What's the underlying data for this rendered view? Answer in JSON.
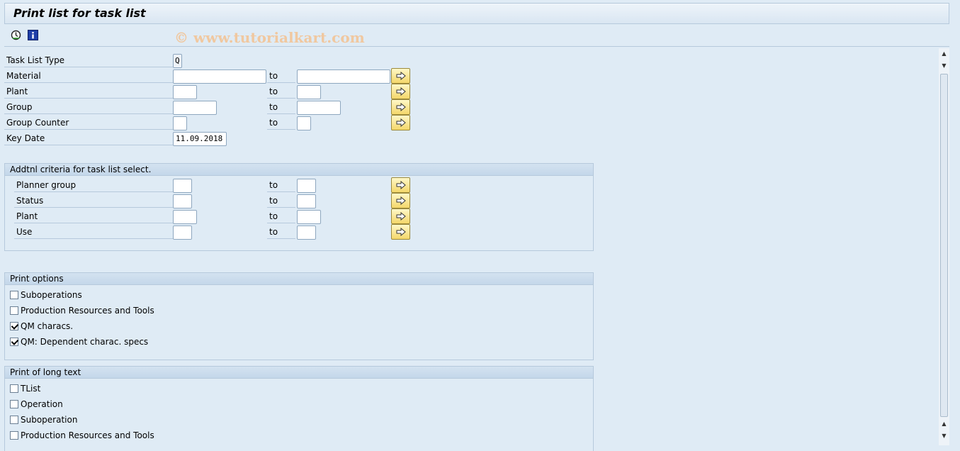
{
  "title": "Print list for task list",
  "watermark": "© www.tutorialkart.com",
  "toolbar": {
    "execute_icon": "execute-clock-icon",
    "info_icon": "info-icon"
  },
  "to_label": "to",
  "fields": {
    "task_list_type": {
      "label": "Task List Type",
      "value": "Q"
    },
    "material": {
      "label": "Material",
      "from": "",
      "to": ""
    },
    "plant": {
      "label": "Plant",
      "from": "",
      "to": ""
    },
    "group": {
      "label": "Group",
      "from": "",
      "to": ""
    },
    "group_counter": {
      "label": "Group Counter",
      "from": "",
      "to": ""
    },
    "key_date": {
      "label": "Key Date",
      "value": "11.09.2018"
    }
  },
  "addtnl": {
    "title": "Addtnl criteria for task list select.",
    "planner_group": "Planner group",
    "status": "Status",
    "plant": "Plant",
    "use": "Use"
  },
  "print_options": {
    "title": "Print options",
    "items": [
      {
        "label": "Suboperations",
        "checked": false
      },
      {
        "label": "Production Resources and Tools",
        "checked": false
      },
      {
        "label": "QM characs.",
        "checked": true
      },
      {
        "label": "QM: Dependent charac. specs",
        "checked": true
      }
    ]
  },
  "long_text": {
    "title": "Print of long text",
    "items": [
      {
        "label": "TList",
        "checked": false
      },
      {
        "label": "Operation",
        "checked": false
      },
      {
        "label": "Suboperation",
        "checked": false
      },
      {
        "label": "Production Resources and Tools",
        "checked": false
      }
    ]
  },
  "colors": {
    "background": "#dfebf5",
    "arrow_button": "#f4d76a"
  }
}
